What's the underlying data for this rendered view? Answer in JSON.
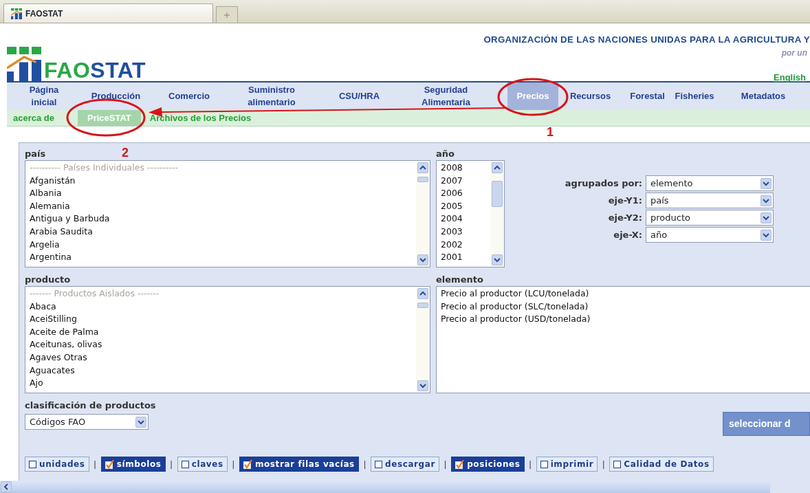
{
  "browser_tab": {
    "title": "FAOSTAT"
  },
  "header": {
    "logo": [
      "FAO",
      "STAT"
    ],
    "org_title": "ORGANIZACIÓN DE LAS NACIONES UNIDAS PARA LA AGRICULTURA Y",
    "tagline": "por un",
    "language": "English"
  },
  "nav": [
    {
      "label": "Página inicial",
      "selected": false
    },
    {
      "label": "Producción",
      "selected": false
    },
    {
      "label": "Comercio",
      "selected": false
    },
    {
      "label": "Suministro alimentario",
      "selected": false
    },
    {
      "label": "CSU/HRA",
      "selected": false
    },
    {
      "label": "Seguridad Alimentaria",
      "selected": false
    },
    {
      "label": "Precios",
      "selected": true
    },
    {
      "label": "Recursos",
      "selected": false
    },
    {
      "label": "Forestal",
      "selected": false
    },
    {
      "label": "Fisheries",
      "selected": false
    },
    {
      "label": "Metadatos",
      "selected": false
    }
  ],
  "subnav": [
    {
      "label": "acerca de",
      "selected": false
    },
    {
      "label": "PriceSTAT",
      "selected": true
    },
    {
      "label": "Archivos de los Precios",
      "selected": false
    }
  ],
  "country": {
    "label": "país",
    "items": [
      {
        "kind": "header",
        "text": "---------- Países Individuales ----------"
      },
      {
        "kind": "option",
        "text": "Afganistán"
      },
      {
        "kind": "option",
        "text": "Albania"
      },
      {
        "kind": "option",
        "text": "Alemania"
      },
      {
        "kind": "option",
        "text": "Antigua y Barbuda"
      },
      {
        "kind": "option",
        "text": "Arabia Saudita"
      },
      {
        "kind": "option",
        "text": "Argelia"
      },
      {
        "kind": "option",
        "text": "Argentina"
      }
    ]
  },
  "year": {
    "label": "año",
    "items": [
      "2008",
      "2007",
      "2006",
      "2005",
      "2004",
      "2003",
      "2002",
      "2001"
    ]
  },
  "axes": [
    {
      "label": "agrupados por:",
      "value": "elemento"
    },
    {
      "label": "eje-Y1:",
      "value": "país"
    },
    {
      "label": "eje-Y2:",
      "value": "producto"
    },
    {
      "label": "eje-X:",
      "value": "año"
    }
  ],
  "product": {
    "label": "producto",
    "items": [
      {
        "kind": "header",
        "text": "------- Productos Aislados -------"
      },
      {
        "kind": "option",
        "text": "Abaca"
      },
      {
        "kind": "option",
        "text": "AceiStilling"
      },
      {
        "kind": "option",
        "text": "Aceite de Palma"
      },
      {
        "kind": "option",
        "text": "Aceitunas, olivas"
      },
      {
        "kind": "option",
        "text": "Agaves Otras"
      },
      {
        "kind": "option",
        "text": "Aguacates"
      },
      {
        "kind": "option",
        "text": "Ajo"
      }
    ]
  },
  "element": {
    "label": "elemento",
    "items": [
      "Precio al productor (LCU/tonelada)",
      "Precio al productor (SLC/tonelada)",
      "Precio al productor (USD/tonelada)"
    ]
  },
  "classification": {
    "label": "clasificación de productos",
    "value": "Códigos FAO"
  },
  "submit_button": "seleccionar d",
  "toggle_separator": "|",
  "toggles": [
    {
      "label": "unidades",
      "checked": false
    },
    {
      "label": "símbolos",
      "checked": true
    },
    {
      "label": "claves",
      "checked": false
    },
    {
      "label": "mostrar filas vacías",
      "checked": true
    },
    {
      "label": "descargar",
      "checked": false
    },
    {
      "label": "posiciones",
      "checked": true
    },
    {
      "label": "imprimir",
      "checked": false
    },
    {
      "label": "Calidad de Datos",
      "checked": false
    }
  ],
  "annotations": [
    {
      "label": "1"
    },
    {
      "label": "2"
    }
  ]
}
